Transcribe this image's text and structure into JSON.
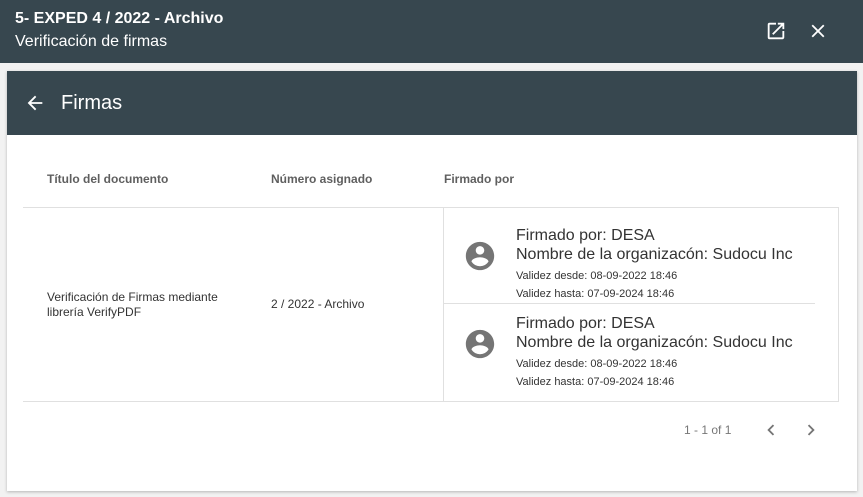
{
  "dialog": {
    "title": "5- EXPED 4 / 2022 - Archivo",
    "subtitle": "Verificación de firmas",
    "icons": {
      "open": "open-in-new-icon",
      "close": "close-icon"
    }
  },
  "card": {
    "title": "Firmas",
    "back_icon": "arrow-back-icon"
  },
  "table": {
    "columns": [
      "Título del documento",
      "Número asignado",
      "Firmado por"
    ],
    "rows": [
      {
        "title": "Verificación de Firmas mediante librería VerifyPDF",
        "number": "2 / 2022 - Archivo",
        "signers": [
          {
            "signed_by": "Firmado por: DESA",
            "organization": "Nombre de la organizacón: Sudocu Inc",
            "valid_from": "Validez desde: 08-09-2022 18:46",
            "valid_to": "Validez hasta: 07-09-2024 18:46"
          },
          {
            "signed_by": "Firmado por: DESA",
            "organization": "Nombre de la organizacón: Sudocu Inc",
            "valid_from": "Validez desde: 08-09-2022 18:46",
            "valid_to": "Validez hasta: 07-09-2024 18:46"
          }
        ]
      }
    ]
  },
  "paginator": {
    "range": "1 - 1 of 1",
    "icons": {
      "prev": "chevron-left-icon",
      "next": "chevron-right-icon"
    }
  },
  "colors": {
    "header_bg": "#37474f",
    "icon_gray": "#757575"
  }
}
